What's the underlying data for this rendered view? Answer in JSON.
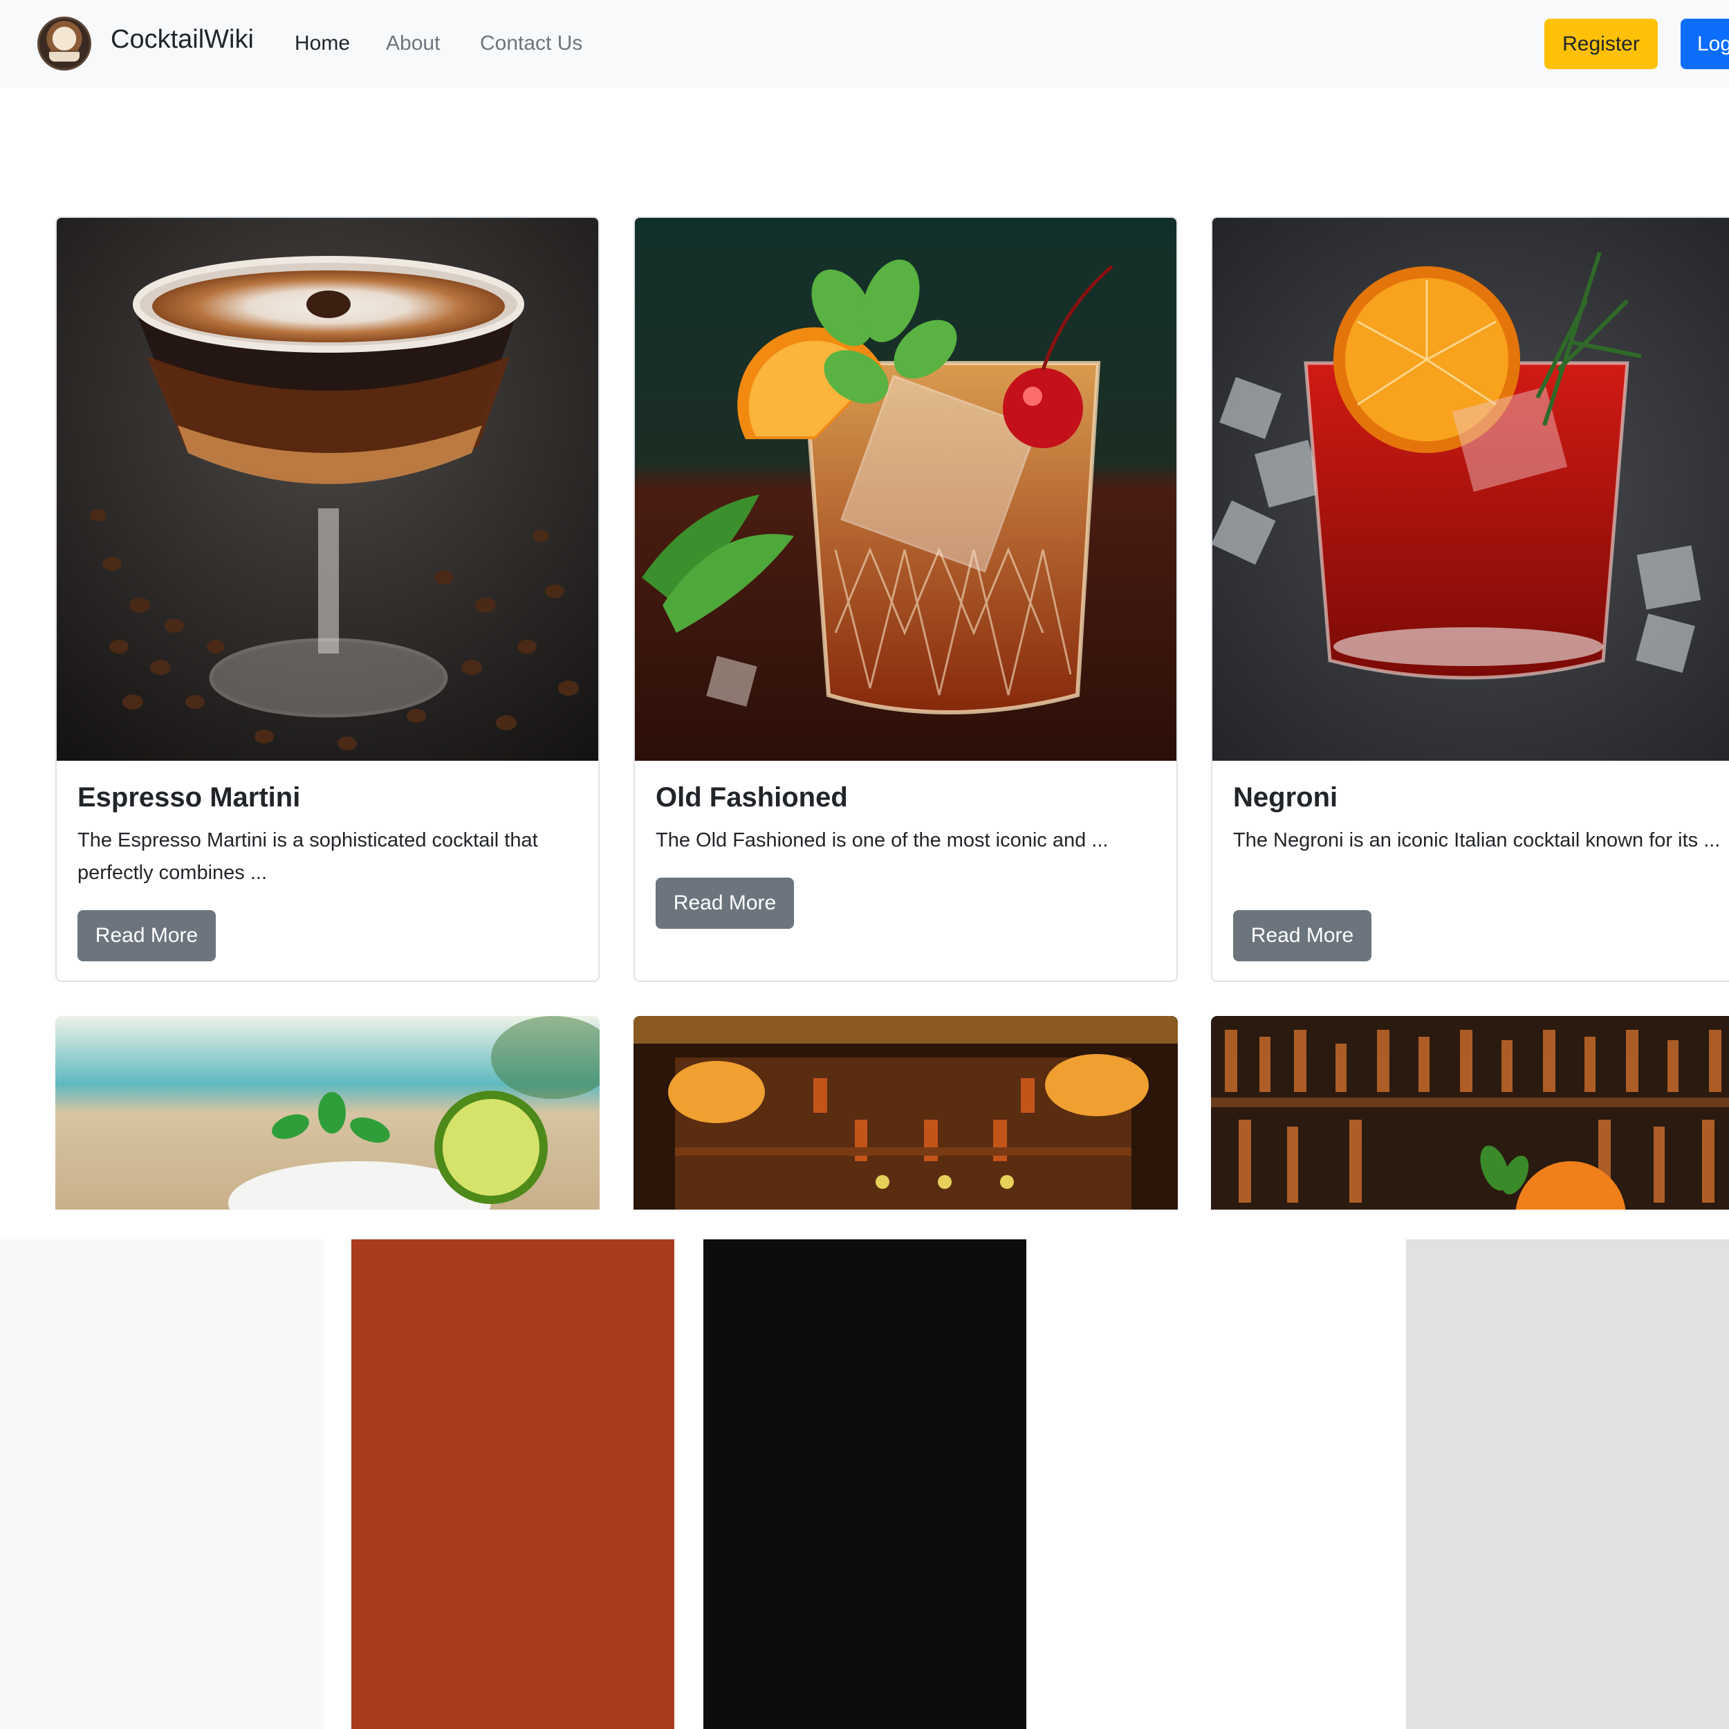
{
  "navbar": {
    "brand": "CocktailWiki",
    "links": [
      "Home",
      "About",
      "Contact Us"
    ],
    "register": "Register",
    "login": "Login"
  },
  "cards": [
    {
      "title": "Espresso Martini",
      "text": "The Espresso Martini is a sophisticated cocktail that perfectly combines ...",
      "button": "Read More"
    },
    {
      "title": "Old Fashioned",
      "text": "The Old Fashioned is one of the most iconic and ...",
      "button": "Read More"
    },
    {
      "title": "Negroni",
      "text": "The Negroni is an iconic Italian cocktail known for its ...",
      "button": "Read More"
    }
  ],
  "palette": [
    "#f7f8fa",
    "#aa3b1f",
    "#0d0d10",
    "#ffffff",
    "#e1e2e0"
  ]
}
